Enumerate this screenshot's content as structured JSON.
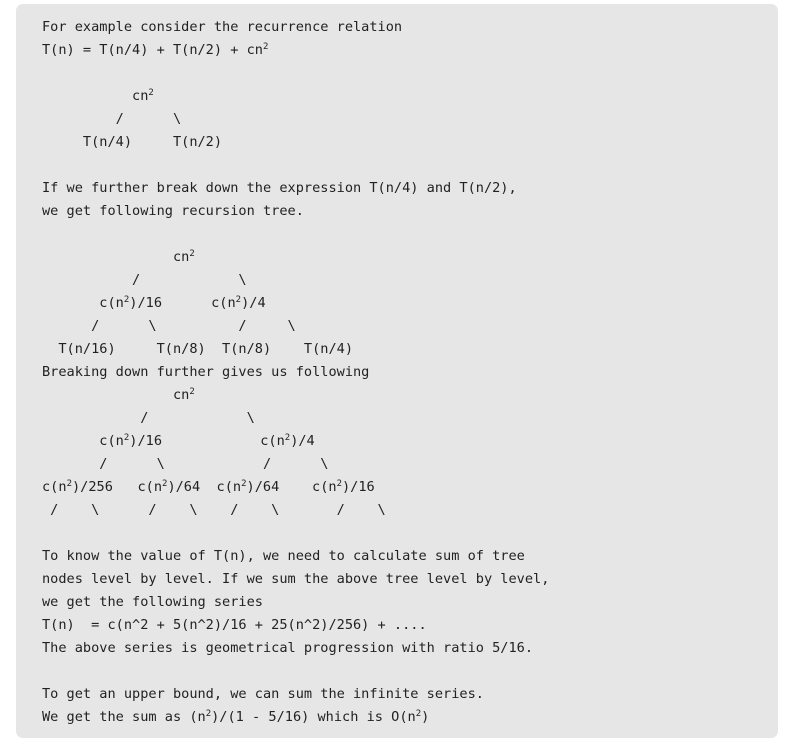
{
  "code_block": {
    "lines": [
      "For example consider the recurrence relation",
      "T(n) = T(n/4) + T(n/2) + cn^{2}",
      "",
      "           cn^{2}",
      "         /      \\",
      "     T(n/4)     T(n/2)",
      "",
      "If we further break down the expression T(n/4) and T(n/2),",
      "we get following recursion tree.",
      "",
      "                cn^{2}",
      "           /            \\",
      "       c(n^{2})/16      c(n^{2})/4",
      "      /      \\          /     \\",
      "  T(n/16)     T(n/8)  T(n/8)    T(n/4)",
      "Breaking down further gives us following",
      "                cn^{2}",
      "            /            \\",
      "       c(n^{2})/16            c(n^{2})/4",
      "       /      \\            /      \\",
      "c(n^{2})/256   c(n^{2})/64  c(n^{2})/64    c(n^{2})/16",
      " /    \\      /    \\    /    \\       /    \\",
      "",
      "To know the value of T(n), we need to calculate sum of tree",
      "nodes level by level. If we sum the above tree level by level,",
      "we get the following series",
      "T(n)  = c(n^2 + 5(n^2)/16 + 25(n^2)/256) + ....",
      "The above series is geometrical progression with ratio 5/16.",
      "",
      "To get an upper bound, we can sum the infinite series.",
      "We get the sum as (n^{2})/(1 - 5/16) which is O(n^{2})"
    ]
  }
}
